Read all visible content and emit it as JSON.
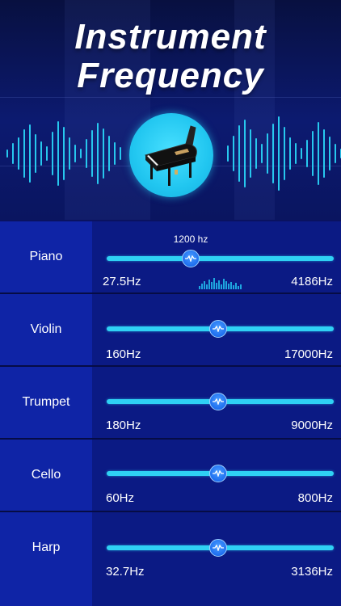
{
  "header": {
    "title_line1": "Instrument",
    "title_line2": "Frequency",
    "emblem_icon": "grand-piano-icon"
  },
  "colors": {
    "background": "#0a1260",
    "label_cell": "#0f24a6",
    "control_cell": "#0b1a84",
    "track": "#2fd1f4",
    "thumb": "#1e6ff0",
    "wave": "#27c8ee"
  },
  "instruments": [
    {
      "name": "Piano",
      "min": "27.5Hz",
      "max": "4186Hz",
      "current": "1200 hz",
      "position": 0.37
    },
    {
      "name": "Violin",
      "min": "160Hz",
      "max": "17000Hz",
      "current": "",
      "position": 0.49
    },
    {
      "name": "Trumpet",
      "min": "180Hz",
      "max": "9000Hz",
      "current": "",
      "position": 0.49
    },
    {
      "name": "Cello",
      "min": "60Hz",
      "max": "800Hz",
      "current": "",
      "position": 0.49
    },
    {
      "name": "Harp",
      "min": "32.7Hz",
      "max": "3136Hz",
      "current": "",
      "position": 0.49
    }
  ]
}
